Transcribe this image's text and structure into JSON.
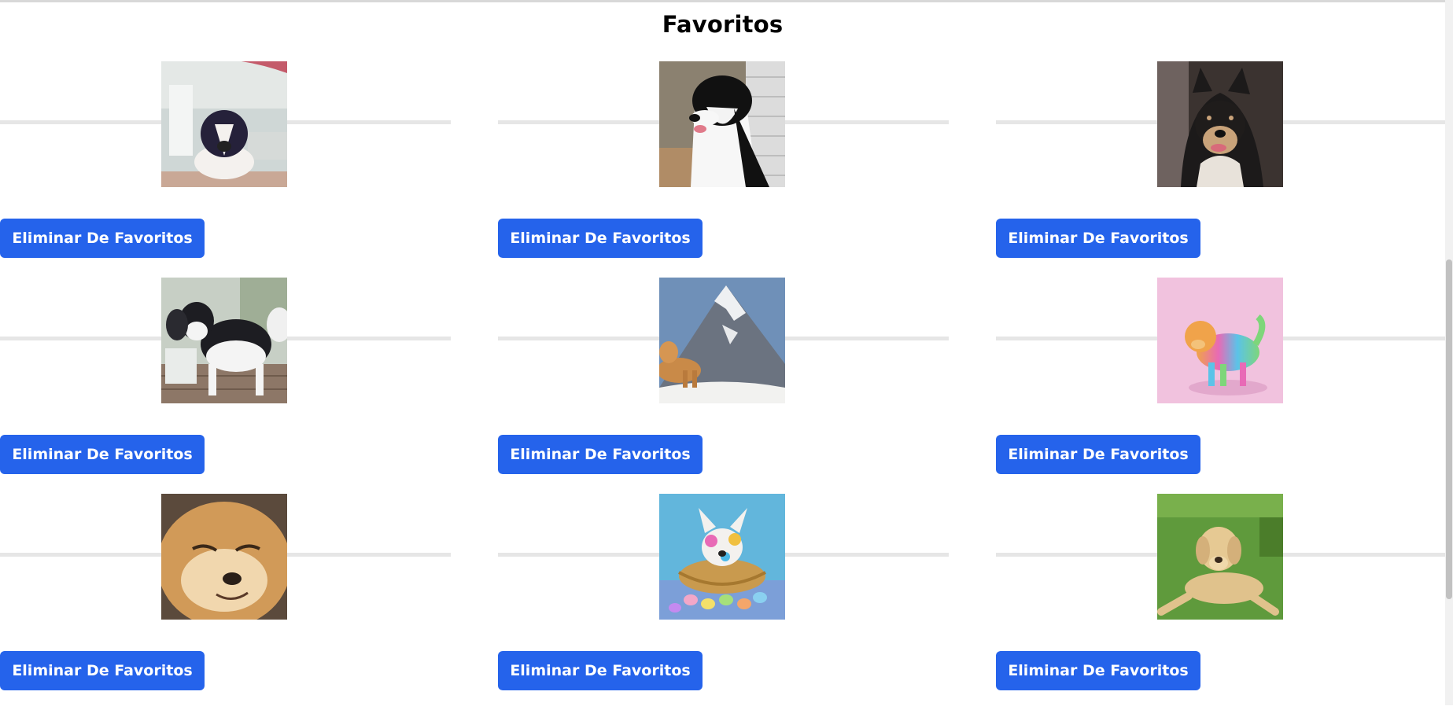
{
  "page": {
    "title": "Favoritos"
  },
  "favorites": [
    {
      "icon": "dog-photo-border-collie-window",
      "button_label": "Eliminar De Favoritos"
    },
    {
      "icon": "dog-photo-border-collie-closeup",
      "button_label": "Eliminar De Favoritos"
    },
    {
      "icon": "dog-photo-finnish-lapphund",
      "button_label": "Eliminar De Favoritos"
    },
    {
      "icon": "dog-photo-malamutes",
      "button_label": "Eliminar De Favoritos"
    },
    {
      "icon": "dog-photo-golden-mountain",
      "button_label": "Eliminar De Favoritos"
    },
    {
      "icon": "dog-photo-rainbow-golden",
      "button_label": "Eliminar De Favoritos"
    },
    {
      "icon": "dog-photo-smiling-shiba",
      "button_label": "Eliminar De Favoritos"
    },
    {
      "icon": "dog-photo-easter-puppy",
      "button_label": "Eliminar De Favoritos"
    },
    {
      "icon": "dog-photo-labrador-grass",
      "button_label": "Eliminar De Favoritos"
    }
  ],
  "colors": {
    "button": "#2563eb",
    "rule": "#e6e6e6"
  }
}
